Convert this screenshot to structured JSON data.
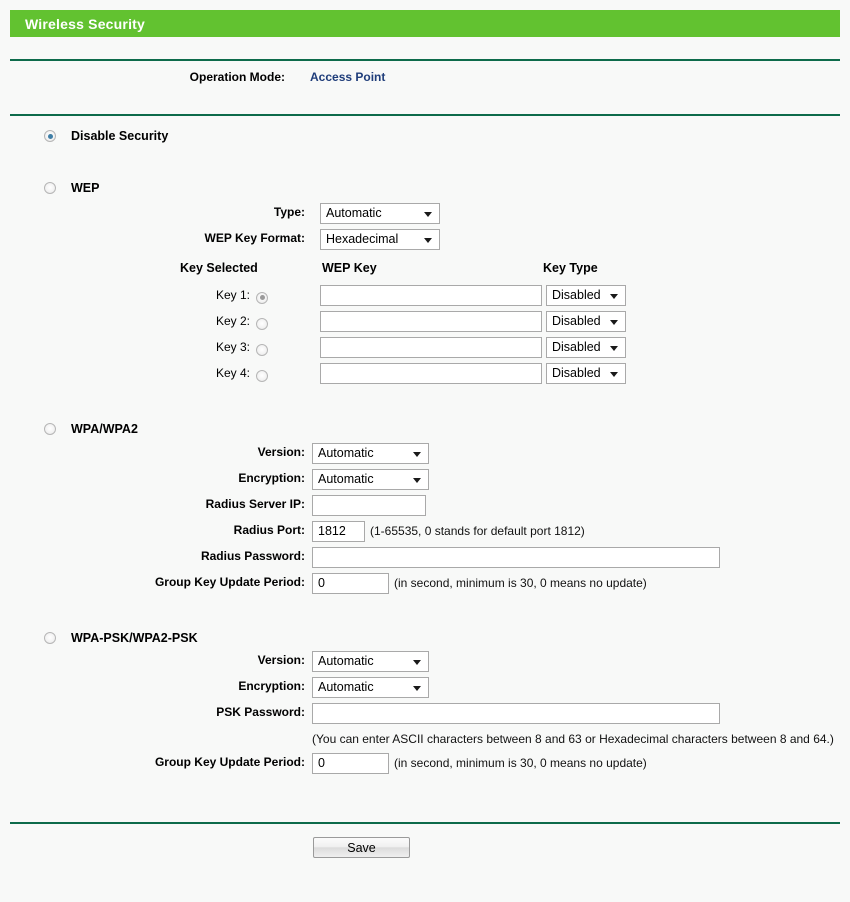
{
  "header": {
    "title": "Wireless Security"
  },
  "operation_mode": {
    "label": "Operation Mode:",
    "value": "Access Point"
  },
  "sections": {
    "disable": {
      "label": "Disable Security",
      "selected": true
    },
    "wep": {
      "label": "WEP",
      "selected": false,
      "type_label": "Type:",
      "type_value": "Automatic",
      "key_format_label": "WEP Key Format:",
      "key_format_value": "Hexadecimal",
      "col_key_selected": "Key Selected",
      "col_wep_key": "WEP Key",
      "col_key_type": "Key Type",
      "keys": [
        {
          "label": "Key 1:",
          "value": "",
          "key_type": "Disabled",
          "selected": true
        },
        {
          "label": "Key 2:",
          "value": "",
          "key_type": "Disabled",
          "selected": false
        },
        {
          "label": "Key 3:",
          "value": "",
          "key_type": "Disabled",
          "selected": false
        },
        {
          "label": "Key 4:",
          "value": "",
          "key_type": "Disabled",
          "selected": false
        }
      ]
    },
    "wpa": {
      "label": "WPA/WPA2",
      "selected": false,
      "version_label": "Version:",
      "version_value": "Automatic",
      "encryption_label": "Encryption:",
      "encryption_value": "Automatic",
      "radius_ip_label": "Radius Server IP:",
      "radius_ip_value": "",
      "radius_port_label": "Radius Port:",
      "radius_port_value": "1812",
      "radius_port_hint": "(1-65535, 0 stands for default port 1812)",
      "radius_password_label": "Radius Password:",
      "radius_password_value": "",
      "group_key_label": "Group Key Update Period:",
      "group_key_value": "0",
      "group_key_hint": "(in second, minimum is 30, 0 means no update)"
    },
    "wpapsk": {
      "label": "WPA-PSK/WPA2-PSK",
      "selected": false,
      "version_label": "Version:",
      "version_value": "Automatic",
      "encryption_label": "Encryption:",
      "encryption_value": "Automatic",
      "psk_password_label": "PSK Password:",
      "psk_password_value": "",
      "psk_hint": "(You can enter ASCII characters between 8 and 63 or Hexadecimal characters between 8 and 64.)",
      "group_key_label": "Group Key Update Period:",
      "group_key_value": "0",
      "group_key_hint": "(in second, minimum is 30, 0 means no update)"
    }
  },
  "footer": {
    "save_label": "Save"
  },
  "colors": {
    "header_green": "#62c230",
    "divider_green": "#0d6b4b",
    "link_blue": "#1f3d7a",
    "page_background": "#f8f9f8"
  }
}
